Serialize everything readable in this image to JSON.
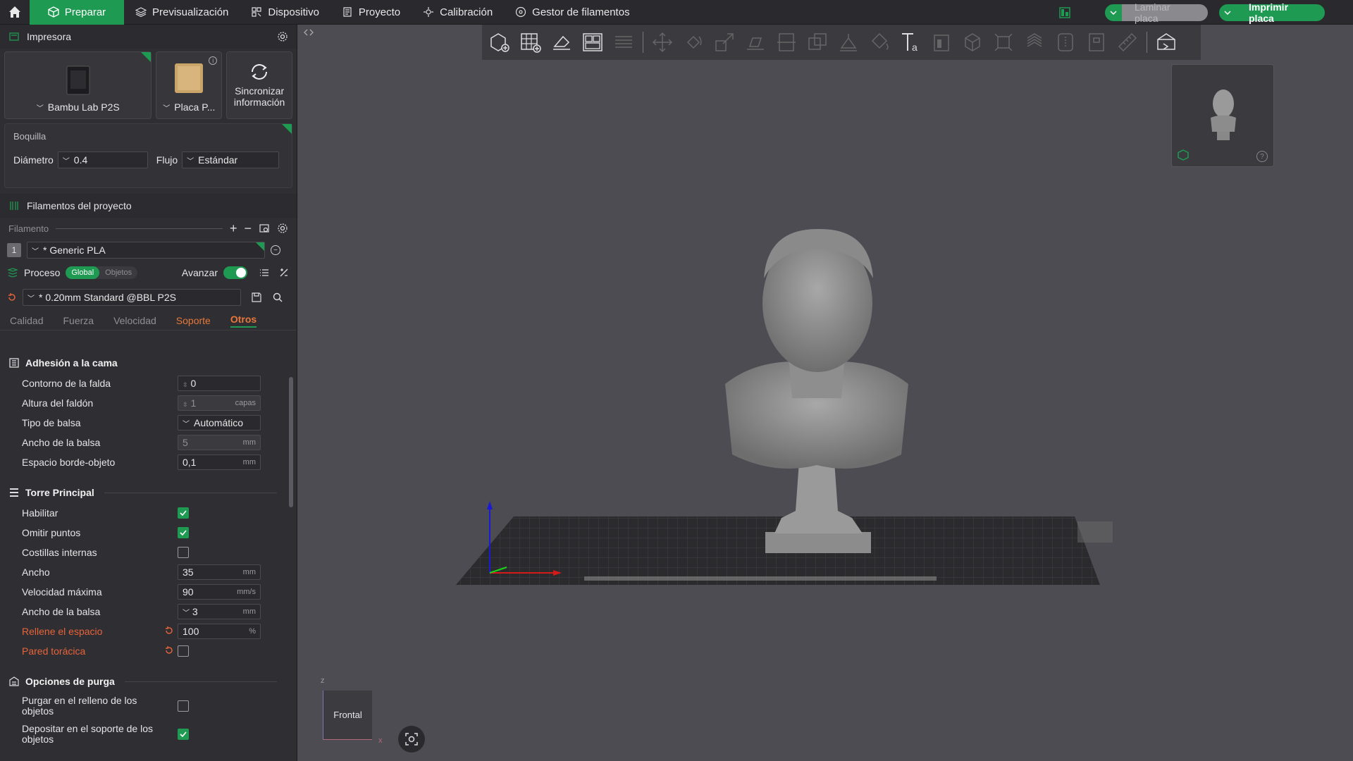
{
  "topbar": {
    "tabs": [
      {
        "label": "Preparar",
        "icon": "cube-icon"
      },
      {
        "label": "Previsualización",
        "icon": "layers-icon"
      },
      {
        "label": "Dispositivo",
        "icon": "device-icon"
      },
      {
        "label": "Proyecto",
        "icon": "document-icon"
      },
      {
        "label": "Calibración",
        "icon": "calibration-icon"
      },
      {
        "label": "Gestor de filamentos",
        "icon": "spool-icon"
      }
    ],
    "slice_label": "Laminar placa",
    "print_label": "Imprimir placa",
    "accent": "#1f9a52"
  },
  "printer": {
    "header": "Impresora",
    "printer_name": "Bambu Lab P2S",
    "plate_name": "Placa P...",
    "sync_label": "Sincronizar información"
  },
  "nozzle": {
    "title": "Boquilla",
    "diameter_label": "Diámetro",
    "diameter_value": "0.4",
    "flow_label": "Flujo",
    "flow_value": "Estándar"
  },
  "filaments": {
    "header": "Filamentos del proyecto",
    "column_label": "Filamento",
    "items": [
      {
        "index": "1",
        "name": "* Generic PLA"
      }
    ]
  },
  "process": {
    "label": "Proceso",
    "mode_global": "Global",
    "mode_objects": "Objetos",
    "advanced_label": "Avanzar",
    "preset": "* 0.20mm Standard @BBL P2S",
    "tabs": [
      "Calidad",
      "Fuerza",
      "Velocidad",
      "Soporte",
      "Otros"
    ],
    "active_tab": "Otros"
  },
  "groups": {
    "bed_adhesion": {
      "title": "Adhesión a la cama",
      "rows": [
        {
          "label": "Contorno de la falda",
          "value": "0",
          "unit": ""
        },
        {
          "label": "Altura del faldón",
          "value": "1",
          "unit": "capas"
        },
        {
          "label": "Tipo de balsa",
          "value": "Automático",
          "unit": ""
        },
        {
          "label": "Ancho de la balsa",
          "value": "5",
          "unit": "mm"
        },
        {
          "label": "Espacio borde-objeto",
          "value": "0,1",
          "unit": "mm"
        }
      ]
    },
    "prime_tower": {
      "title": "Torre Principal",
      "rows": [
        {
          "label": "Habilitar",
          "checked": true
        },
        {
          "label": "Omitir puntos",
          "checked": true
        },
        {
          "label": "Costillas internas",
          "checked": false
        },
        {
          "label": "Ancho",
          "value": "35",
          "unit": "mm"
        },
        {
          "label": "Velocidad máxima",
          "value": "90",
          "unit": "mm/s"
        },
        {
          "label": "Ancho de la balsa",
          "value": "3",
          "unit": "mm"
        },
        {
          "label": "Rellene el espacio",
          "value": "100",
          "unit": "%"
        },
        {
          "label": "Pared torácica",
          "checked": false
        }
      ]
    },
    "purge": {
      "title": "Opciones de purga",
      "rows": [
        {
          "label": "Purgar en el relleno de los objetos",
          "checked": false
        },
        {
          "label": "Depositar en el soporte de los objetos",
          "checked": true
        }
      ]
    }
  },
  "viewport": {
    "view_label": "Frontal",
    "axis_z": "z",
    "axis_x": "x"
  }
}
